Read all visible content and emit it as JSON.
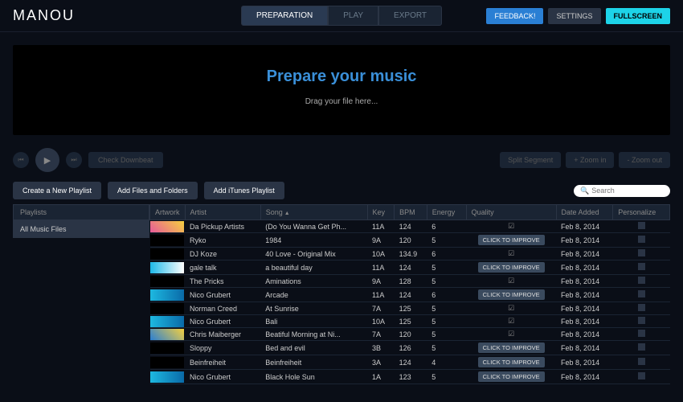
{
  "logo": "MANOU",
  "nav": {
    "preparation": "PREPARATION",
    "play": "PLAY",
    "export": "EXPORT"
  },
  "header_buttons": {
    "feedback": "FEEDBACK!",
    "settings": "SETTINGS",
    "fullscreen": "FULLSCREEN"
  },
  "hero": {
    "title": "Prepare your music",
    "subtitle": "Drag your file here..."
  },
  "toolbar": {
    "check_downbeat": "Check Downbeat",
    "split_segment": "Split Segment",
    "zoom_in": "+ Zoom in",
    "zoom_out": "- Zoom out"
  },
  "actions": {
    "create_playlist": "Create a New Playlist",
    "add_files": "Add Files and Folders",
    "add_itunes": "Add iTunes Playlist"
  },
  "search": {
    "placeholder": "Search"
  },
  "sidebar": {
    "header": "Playlists",
    "item0": "All Music Files"
  },
  "columns": {
    "artwork": "Artwork",
    "artist": "Artist",
    "song": "Song",
    "key": "Key",
    "bpm": "BPM",
    "energy": "Energy",
    "quality": "Quality",
    "date": "Date Added",
    "personalize": "Personalize"
  },
  "quality_labels": {
    "improve": "CLICK TO IMPROVE"
  },
  "tracks": [
    {
      "artist": "Da Pickup Artists",
      "song": "(Do You Wanna Get Ph...",
      "key": "11A",
      "bpm": "124",
      "energy": "6",
      "quality": "check",
      "date": "Feb 8, 2014",
      "art": "a1"
    },
    {
      "artist": "Ryko",
      "song": "1984",
      "key": "9A",
      "bpm": "120",
      "energy": "5",
      "quality": "improve",
      "date": "Feb 8, 2014",
      "art": "a2"
    },
    {
      "artist": "DJ Koze",
      "song": "40 Love - Original Mix",
      "key": "10A",
      "bpm": "134.9",
      "energy": "6",
      "quality": "check",
      "date": "Feb 8, 2014",
      "art": "a2"
    },
    {
      "artist": "gale talk",
      "song": "a beautiful day",
      "key": "11A",
      "bpm": "124",
      "energy": "5",
      "quality": "improve",
      "date": "Feb 8, 2014",
      "art": "a3"
    },
    {
      "artist": "The Pricks",
      "song": "Aminations",
      "key": "9A",
      "bpm": "128",
      "energy": "5",
      "quality": "check",
      "date": "Feb 8, 2014",
      "art": "a2"
    },
    {
      "artist": "Nico Grubert",
      "song": "Arcade",
      "key": "11A",
      "bpm": "124",
      "energy": "6",
      "quality": "improve",
      "date": "Feb 8, 2014",
      "art": "a4"
    },
    {
      "artist": "Norman Creed",
      "song": "At Sunrise",
      "key": "7A",
      "bpm": "125",
      "energy": "5",
      "quality": "check",
      "date": "Feb 8, 2014",
      "art": "a2"
    },
    {
      "artist": "Nico Grubert",
      "song": "Bali",
      "key": "10A",
      "bpm": "125",
      "energy": "5",
      "quality": "check",
      "date": "Feb 8, 2014",
      "art": "a4"
    },
    {
      "artist": "Chris Maiberger",
      "song": "Beatiful Morning at Ni...",
      "key": "7A",
      "bpm": "120",
      "energy": "5",
      "quality": "check",
      "date": "Feb 8, 2014",
      "art": "a5"
    },
    {
      "artist": "Sloppy",
      "song": "Bed and evil",
      "key": "3B",
      "bpm": "126",
      "energy": "5",
      "quality": "improve",
      "date": "Feb 8, 2014",
      "art": "a2"
    },
    {
      "artist": "Beinfreiheit",
      "song": "Beinfreiheit",
      "key": "3A",
      "bpm": "124",
      "energy": "4",
      "quality": "improve",
      "date": "Feb 8, 2014",
      "art": "a2"
    },
    {
      "artist": "Nico Grubert",
      "song": "Black Hole Sun",
      "key": "1A",
      "bpm": "123",
      "energy": "5",
      "quality": "improve",
      "date": "Feb 8, 2014",
      "art": "a4"
    }
  ]
}
